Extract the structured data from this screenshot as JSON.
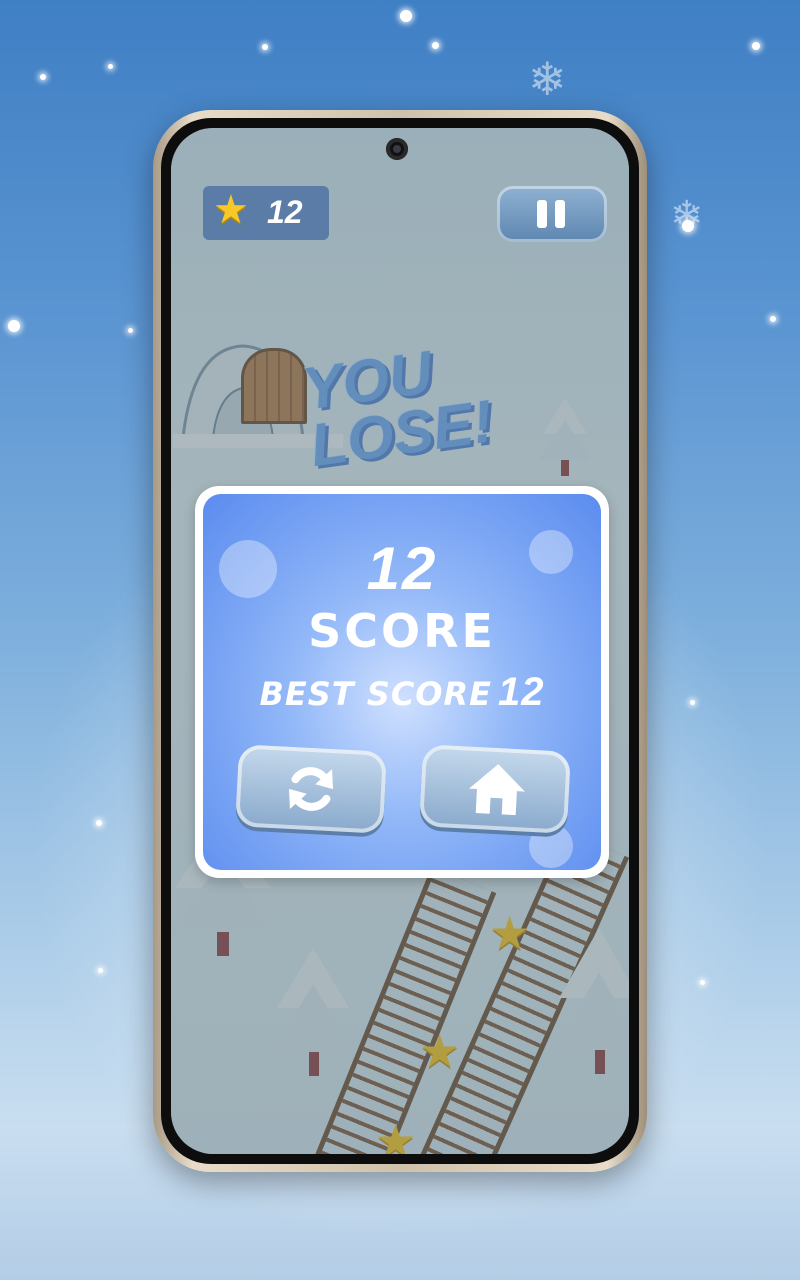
{
  "hud": {
    "star_count": "12"
  },
  "overlay": {
    "title_line1": "YOU",
    "title_line2": "LOSE!"
  },
  "result": {
    "score_value": "12",
    "score_label": "SCORE",
    "best_label": "BEST SCORE",
    "best_value": "12"
  },
  "icons": {
    "hud_star": "star-icon",
    "pause": "pause-icon",
    "restart": "restart-icon",
    "home": "home-icon",
    "collectible": "star-icon"
  },
  "colors": {
    "panel_blue": "#5a8bef",
    "collectible_star": "#f2c21a",
    "title_blue": "#6aa6ee"
  }
}
